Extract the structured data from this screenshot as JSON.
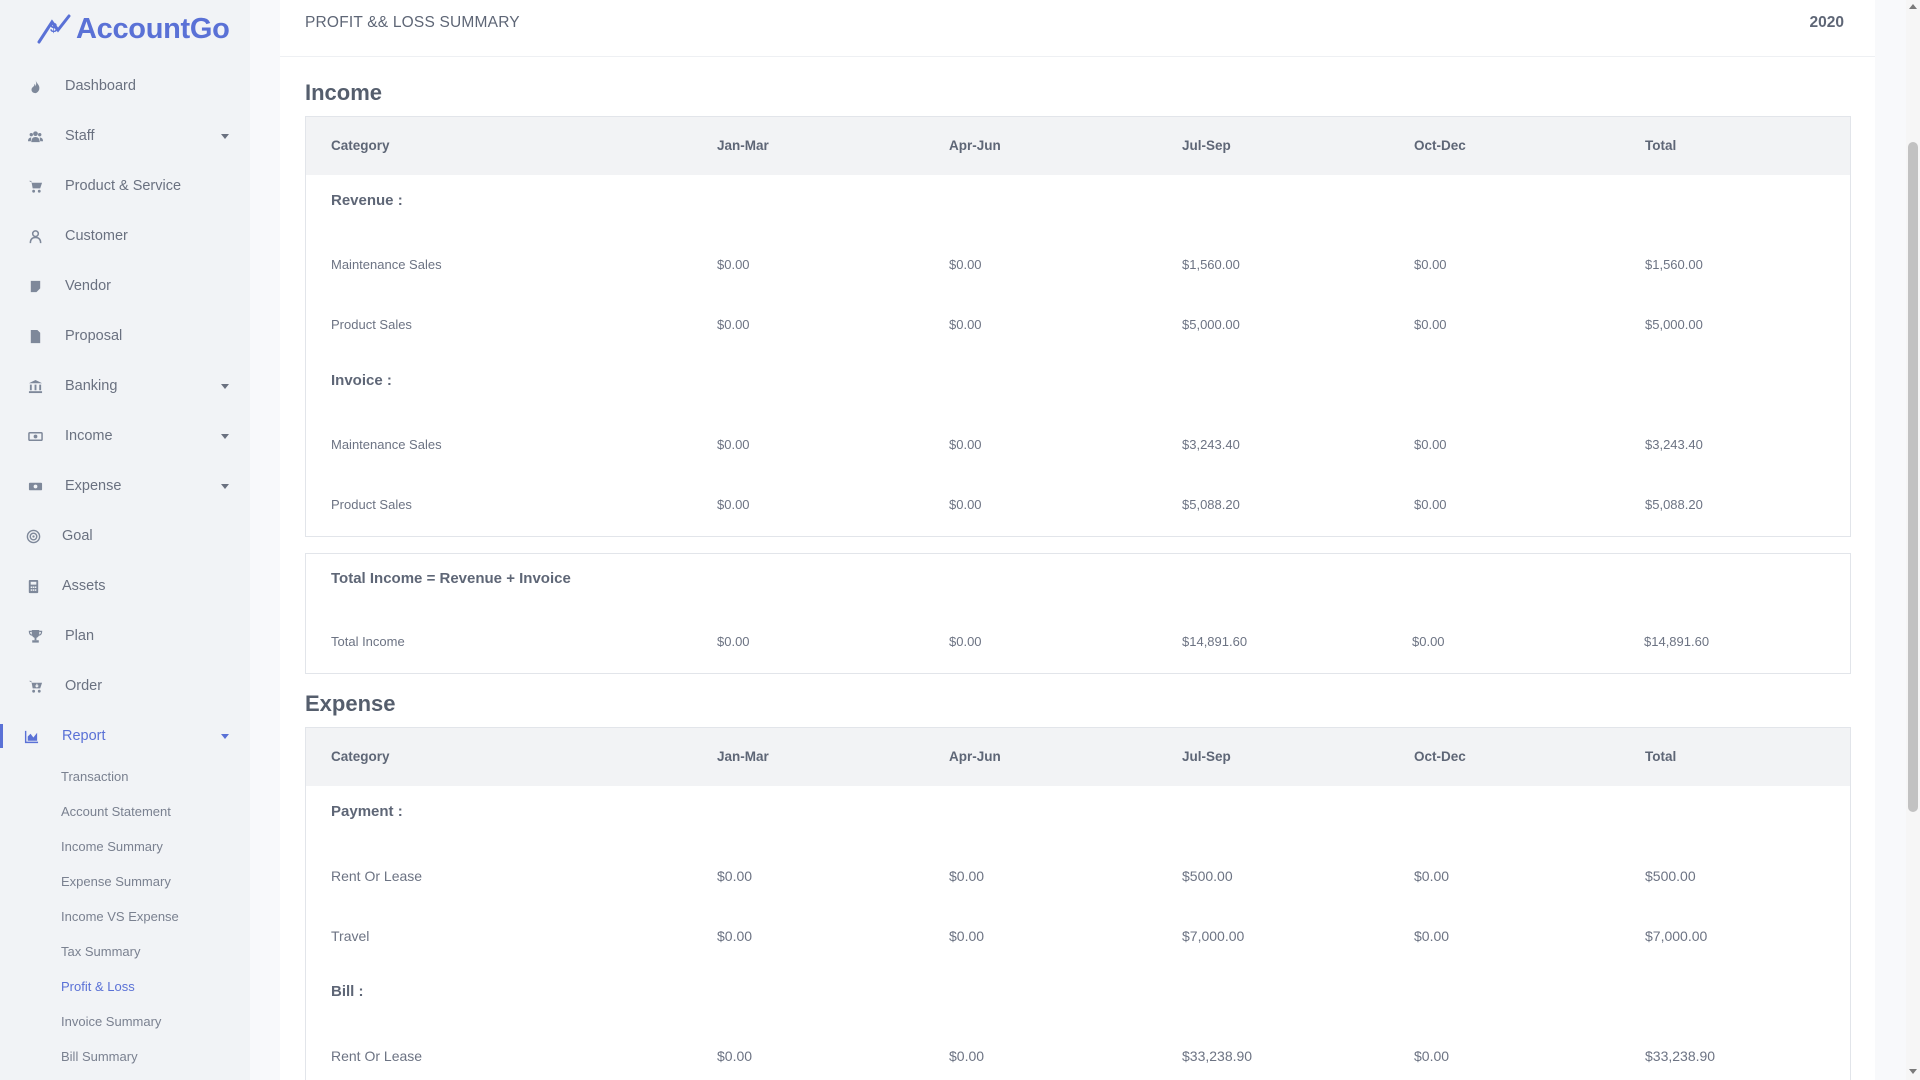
{
  "app": {
    "name": "AccountGo",
    "accent": "#5a71d6"
  },
  "sidebar": {
    "items": [
      {
        "label": "Dashboard",
        "icon": "fire-icon",
        "caret": false
      },
      {
        "label": "Staff",
        "icon": "users-icon",
        "caret": true
      },
      {
        "label": "Product & Service",
        "icon": "cart-icon",
        "caret": false
      },
      {
        "label": "Customer",
        "icon": "user-icon",
        "caret": false
      },
      {
        "label": "Vendor",
        "icon": "note-icon",
        "caret": false
      },
      {
        "label": "Proposal",
        "icon": "file-icon",
        "caret": false
      },
      {
        "label": "Banking",
        "icon": "bank-icon",
        "caret": true
      },
      {
        "label": "Income",
        "icon": "money-icon",
        "caret": true
      },
      {
        "label": "Expense",
        "icon": "money-bill-icon",
        "caret": true
      },
      {
        "label": "Goal",
        "icon": "target-icon",
        "caret": false
      },
      {
        "label": "Assets",
        "icon": "calculator-icon",
        "caret": false
      },
      {
        "label": "Plan",
        "icon": "trophy-icon",
        "caret": false
      },
      {
        "label": "Order",
        "icon": "cart-arrow-icon",
        "caret": false
      },
      {
        "label": "Report",
        "icon": "chart-area-icon",
        "caret": true,
        "active": true
      }
    ],
    "report_sub": [
      "Transaction",
      "Account Statement",
      "Income Summary",
      "Expense Summary",
      "Income VS Expense",
      "Tax Summary",
      "Profit & Loss",
      "Invoice Summary",
      "Bill Summary"
    ]
  },
  "card": {
    "title": "PROFIT && LOSS SUMMARY",
    "year": "2020"
  },
  "income": {
    "title": "Income",
    "headers": [
      "Category",
      "Jan-Mar",
      "Apr-Jun",
      "Jul-Sep",
      "Oct-Dec",
      "Total"
    ],
    "groups": [
      {
        "label": "Revenue :",
        "rows": [
          [
            "Maintenance Sales",
            "$0.00",
            "$0.00",
            "$1,560.00",
            "$0.00",
            "$1,560.00"
          ],
          [
            "Product Sales",
            "$0.00",
            "$0.00",
            "$5,000.00",
            "$0.00",
            "$5,000.00"
          ]
        ]
      },
      {
        "label": "Invoice :",
        "rows": [
          [
            "Maintenance Sales",
            "$0.00",
            "$0.00",
            "$3,243.40",
            "$0.00",
            "$3,243.40"
          ],
          [
            "Product Sales",
            "$0.00",
            "$0.00",
            "$5,088.20",
            "$0.00",
            "$5,088.20"
          ]
        ]
      }
    ],
    "total_label": "Total Income = Revenue + Invoice",
    "total_row": [
      "Total Income",
      "$0.00",
      "$0.00",
      "$14,891.60",
      "$0.00",
      "$14,891.60"
    ]
  },
  "expense": {
    "title": "Expense",
    "headers": [
      "Category",
      "Jan-Mar",
      "Apr-Jun",
      "Jul-Sep",
      "Oct-Dec",
      "Total"
    ],
    "groups": [
      {
        "label": "Payment :",
        "rows": [
          [
            "Rent Or Lease",
            "$0.00",
            "$0.00",
            "$500.00",
            "$0.00",
            "$500.00"
          ],
          [
            "Travel",
            "$0.00",
            "$0.00",
            "$7,000.00",
            "$0.00",
            "$7,000.00"
          ]
        ]
      },
      {
        "label": "Bill :",
        "rows": [
          [
            "Rent Or Lease",
            "$0.00",
            "$0.00",
            "$33,238.90",
            "$0.00",
            "$33,238.90"
          ]
        ]
      }
    ]
  }
}
